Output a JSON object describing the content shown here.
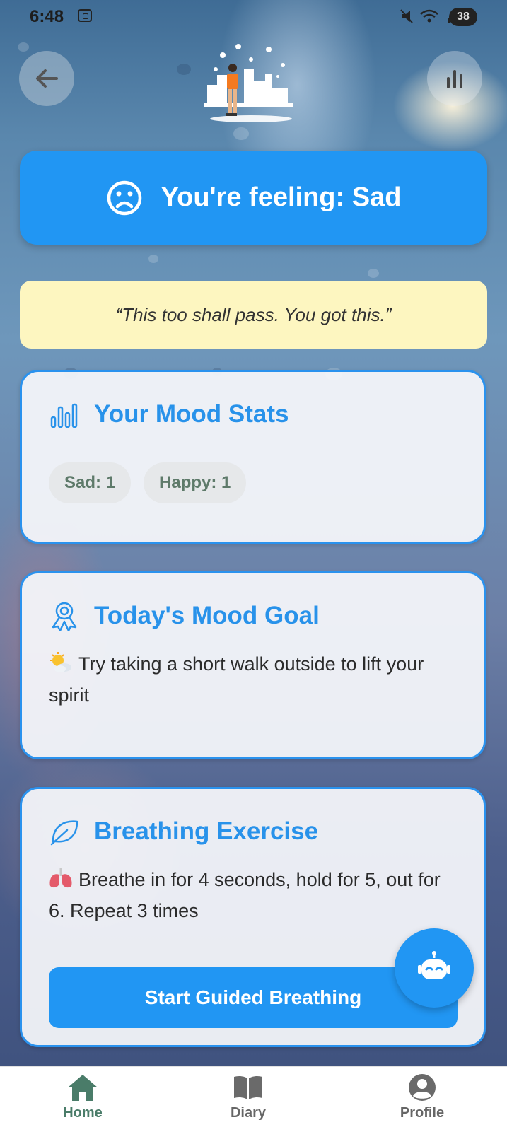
{
  "status_bar": {
    "time": "6:48",
    "battery": "38"
  },
  "banner": {
    "text": "You're feeling: Sad"
  },
  "quote": {
    "text": "“This too shall pass. You got this.”"
  },
  "mood_stats": {
    "title": "Your Mood Stats",
    "chips": [
      "Sad: 1",
      "Happy: 1"
    ]
  },
  "mood_goal": {
    "title": "Today's Mood Goal",
    "text": "Try taking a short walk outside to lift your spirit"
  },
  "breathing": {
    "title": "Breathing Exercise",
    "text": "Breathe in for 4 seconds, hold for 5, out for 6. Repeat 3 times",
    "button_label": "Start Guided Breathing"
  },
  "nav": {
    "items": [
      {
        "label": "Home",
        "icon": "home-icon",
        "active": true
      },
      {
        "label": "Diary",
        "icon": "book-icon",
        "active": false
      },
      {
        "label": "Profile",
        "icon": "user-icon",
        "active": false
      }
    ]
  },
  "colors": {
    "primary": "#2196f3",
    "quote_bg": "#fdf6c0",
    "nav_active": "#4a7c69"
  }
}
